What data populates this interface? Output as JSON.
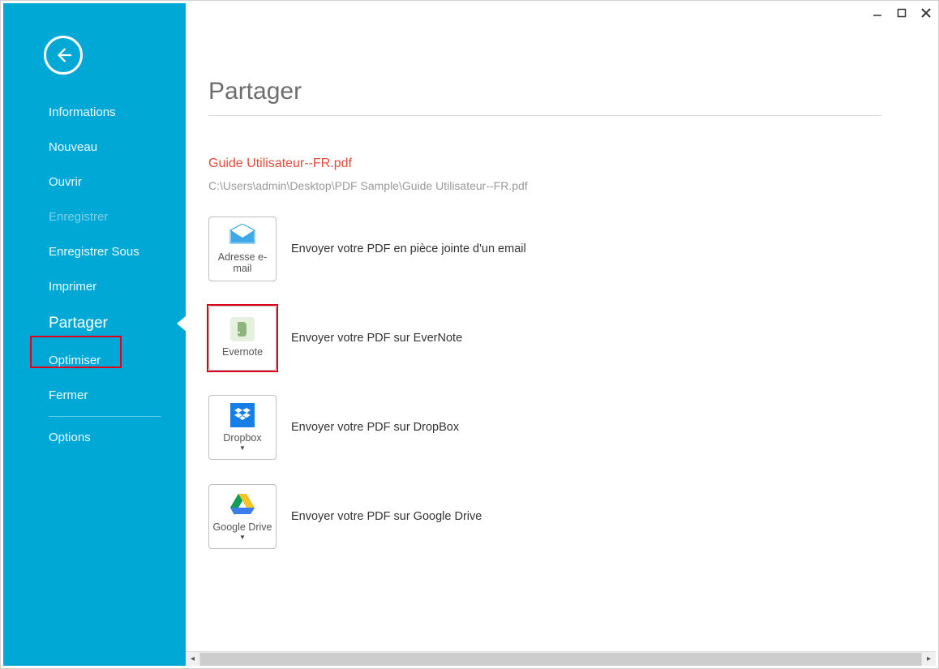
{
  "window": {
    "minimize": "—",
    "maximize": "▢",
    "close": "✕"
  },
  "sidebar": {
    "items": [
      {
        "label": "Informations"
      },
      {
        "label": "Nouveau"
      },
      {
        "label": "Ouvrir"
      },
      {
        "label": "Enregistrer"
      },
      {
        "label": "Enregistrer Sous"
      },
      {
        "label": "Imprimer"
      },
      {
        "label": "Partager"
      },
      {
        "label": "Optimiser"
      },
      {
        "label": "Fermer"
      },
      {
        "label": "Options"
      }
    ]
  },
  "page": {
    "title": "Partager",
    "filename": "Guide Utilisateur--FR.pdf",
    "filepath": "C:\\Users\\admin\\Desktop\\PDF Sample\\Guide Utilisateur--FR.pdf"
  },
  "share": {
    "email": {
      "label": "Adresse e-mail",
      "desc": "Envoyer votre PDF en pièce jointe d'un email"
    },
    "evernote": {
      "label": "Evernote",
      "desc": "Envoyer votre PDF sur EverNote"
    },
    "dropbox": {
      "label": "Dropbox",
      "desc": "Envoyer votre PDF sur DropBox"
    },
    "gdrive": {
      "label": "Google Drive",
      "desc": "Envoyer votre PDF sur Google Drive"
    }
  }
}
